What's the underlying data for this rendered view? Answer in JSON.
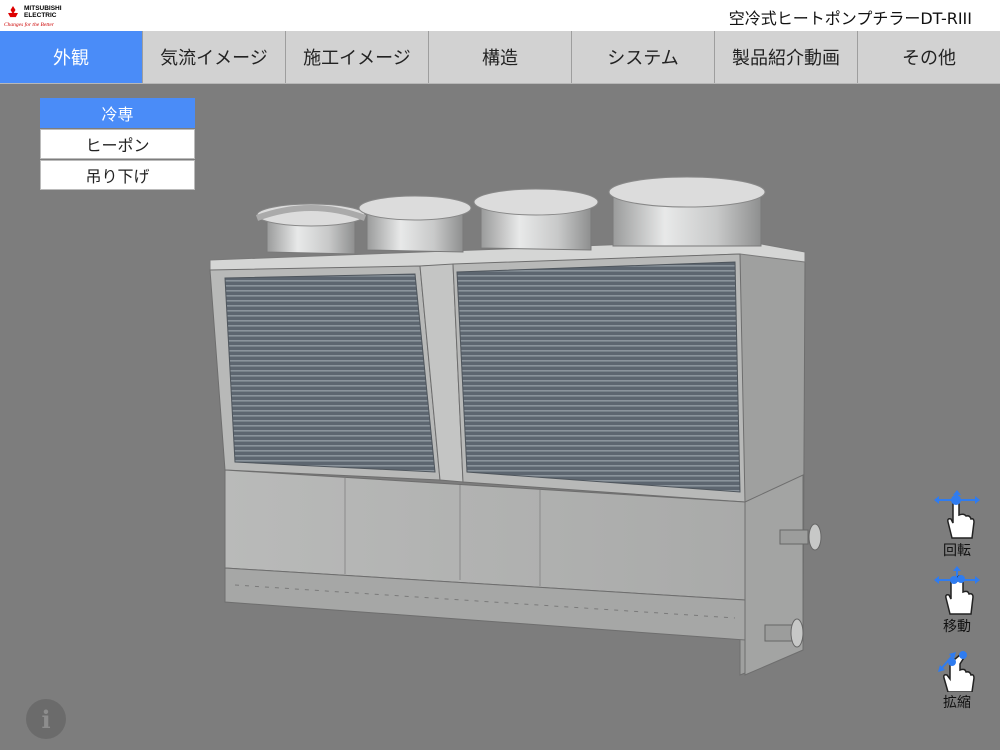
{
  "header": {
    "brand_line1": "MITSUBISHI",
    "brand_line2": "ELECTRIC",
    "tagline": "Changes for the Better",
    "title": "空冷式ヒートポンプチラーDT-RIII"
  },
  "tabs": [
    {
      "label": "外観",
      "active": true
    },
    {
      "label": "気流イメージ",
      "active": false
    },
    {
      "label": "施工イメージ",
      "active": false
    },
    {
      "label": "構造",
      "active": false
    },
    {
      "label": "システム",
      "active": false
    },
    {
      "label": "製品紹介動画",
      "active": false
    },
    {
      "label": "その他",
      "active": false
    }
  ],
  "variants": [
    {
      "label": "冷専",
      "active": true
    },
    {
      "label": "ヒーポン",
      "active": false
    },
    {
      "label": "吊り下げ",
      "active": false
    }
  ],
  "controls": {
    "rotate_label": "回転",
    "move_label": "移動",
    "zoom_label": "拡縮"
  },
  "info_glyph": "i",
  "colors": {
    "accent": "#4a8cf8",
    "background": "#7d7d7d",
    "tabbar": "#d2d2d2",
    "brand_red": "#cc0000"
  },
  "icons": [
    "mitsubishi-logo",
    "rotate-gesture-icon",
    "move-gesture-icon",
    "zoom-gesture-icon",
    "info-icon"
  ]
}
